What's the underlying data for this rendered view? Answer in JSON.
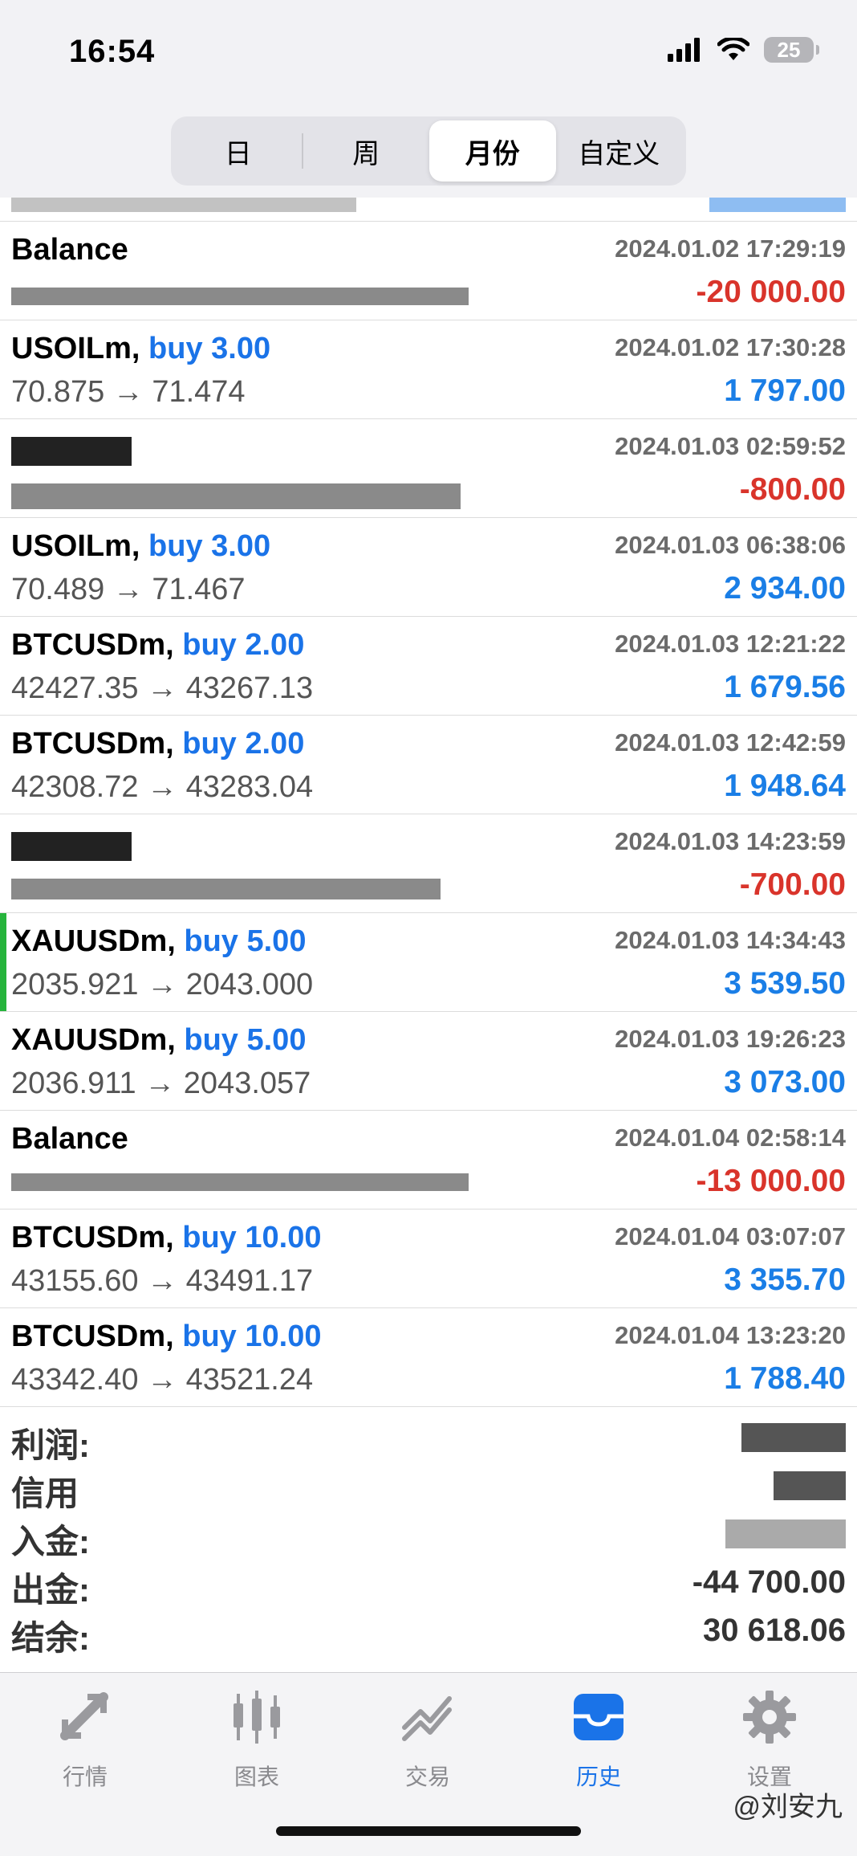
{
  "status": {
    "time": "16:54",
    "battery": "25"
  },
  "tabs_segment": [
    "日",
    "周",
    "月份",
    "自定义"
  ],
  "trades": [
    {
      "symbol": "Balance",
      "direction": "",
      "timestamp": "2024.01.02 17:29:19",
      "prices": "",
      "pnl": "-20 000.00",
      "pnl_sign": "neg"
    },
    {
      "symbol": "USOILm,",
      "direction": "buy 3.00",
      "timestamp": "2024.01.02 17:30:28",
      "prices": "70.875 → 71.474",
      "pnl": "1 797.00",
      "pnl_sign": "pos"
    },
    {
      "symbol": "",
      "direction": "",
      "timestamp": "2024.01.03 02:59:52",
      "prices": "",
      "pnl": "-800.00",
      "pnl_sign": "neg"
    },
    {
      "symbol": "USOILm,",
      "direction": "buy 3.00",
      "timestamp": "2024.01.03 06:38:06",
      "prices": "70.489 → 71.467",
      "pnl": "2 934.00",
      "pnl_sign": "pos"
    },
    {
      "symbol": "BTCUSDm,",
      "direction": "buy 2.00",
      "timestamp": "2024.01.03 12:21:22",
      "prices": "42427.35 → 43267.13",
      "pnl": "1 679.56",
      "pnl_sign": "pos"
    },
    {
      "symbol": "BTCUSDm,",
      "direction": "buy 2.00",
      "timestamp": "2024.01.03 12:42:59",
      "prices": "42308.72 → 43283.04",
      "pnl": "1 948.64",
      "pnl_sign": "pos"
    },
    {
      "symbol": "",
      "direction": "",
      "timestamp": "2024.01.03 14:23:59",
      "prices": "",
      "pnl": "-700.00",
      "pnl_sign": "neg"
    },
    {
      "symbol": "XAUUSDm,",
      "direction": "buy 5.00",
      "timestamp": "2024.01.03 14:34:43",
      "prices": "2035.921 → 2043.000",
      "pnl": "3 539.50",
      "pnl_sign": "pos"
    },
    {
      "symbol": "XAUUSDm,",
      "direction": "buy 5.00",
      "timestamp": "2024.01.03 19:26:23",
      "prices": "2036.911 → 2043.057",
      "pnl": "3 073.00",
      "pnl_sign": "pos"
    },
    {
      "symbol": "Balance",
      "direction": "",
      "timestamp": "2024.01.04 02:58:14",
      "prices": "",
      "pnl": "-13 000.00",
      "pnl_sign": "neg"
    },
    {
      "symbol": "BTCUSDm,",
      "direction": "buy 10.00",
      "timestamp": "2024.01.04 03:07:07",
      "prices": "43155.60 → 43491.17",
      "pnl": "3 355.70",
      "pnl_sign": "pos"
    },
    {
      "symbol": "BTCUSDm,",
      "direction": "buy 10.00",
      "timestamp": "2024.01.04 13:23:20",
      "prices": "43342.40 → 43521.24",
      "pnl": "1 788.40",
      "pnl_sign": "pos"
    }
  ],
  "summary": {
    "profit_label": "利润:",
    "credit_label": "信用",
    "deposit_label": "入金:",
    "withdrawal_label": "出金:",
    "withdrawal_value": "-44 700.00",
    "balance_label": "结余:",
    "balance_value": "30 618.06"
  },
  "tabbar": {
    "quotes": "行情",
    "charts": "图表",
    "trade": "交易",
    "history": "历史",
    "settings": "设置"
  },
  "watermark": "@刘安九",
  "colors": {
    "accent": "#1a73e8",
    "negative": "#d9342b",
    "marker": "#26b43c"
  }
}
